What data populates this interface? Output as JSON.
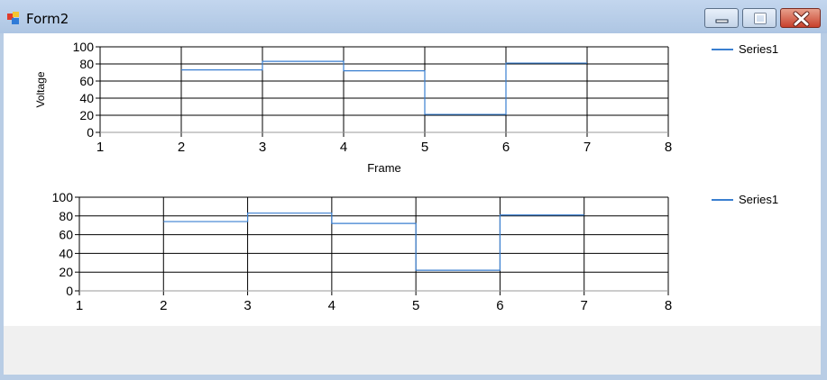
{
  "window": {
    "title": "Form2"
  },
  "charts": [
    {
      "legend": "Series1",
      "xlabel": "Frame",
      "ylabel": "Voltage"
    },
    {
      "legend": "Series1",
      "xlabel": "",
      "ylabel": ""
    }
  ],
  "chart_data": [
    {
      "type": "line",
      "step": true,
      "x": [
        2,
        3,
        4,
        5,
        6,
        7
      ],
      "series": [
        {
          "name": "Series1",
          "values": [
            73,
            83,
            72,
            21,
            81,
            81
          ]
        }
      ],
      "xticks": [
        "1",
        "2",
        "3",
        "4",
        "5",
        "6",
        "7",
        "8"
      ],
      "yticks": [
        "0",
        "20",
        "40",
        "60",
        "80",
        "100"
      ],
      "xlabel": "Frame",
      "ylabel": "Voltage",
      "xlim": [
        1,
        8
      ],
      "ylim": [
        0,
        100
      ],
      "grid": true,
      "legend_position": "top-right",
      "color": "#3a7fd0"
    },
    {
      "type": "line",
      "step": true,
      "x": [
        2,
        3,
        4,
        5,
        6,
        7
      ],
      "series": [
        {
          "name": "Series1",
          "values": [
            74,
            83,
            72,
            22,
            81,
            81
          ]
        }
      ],
      "xticks": [
        "1",
        "2",
        "3",
        "4",
        "5",
        "6",
        "7",
        "8"
      ],
      "yticks": [
        "0",
        "20",
        "40",
        "60",
        "80",
        "100"
      ],
      "xlabel": "",
      "ylabel": "",
      "xlim": [
        1,
        8
      ],
      "ylim": [
        0,
        100
      ],
      "grid": true,
      "legend_position": "top-right",
      "color": "#3a7fd0"
    }
  ]
}
